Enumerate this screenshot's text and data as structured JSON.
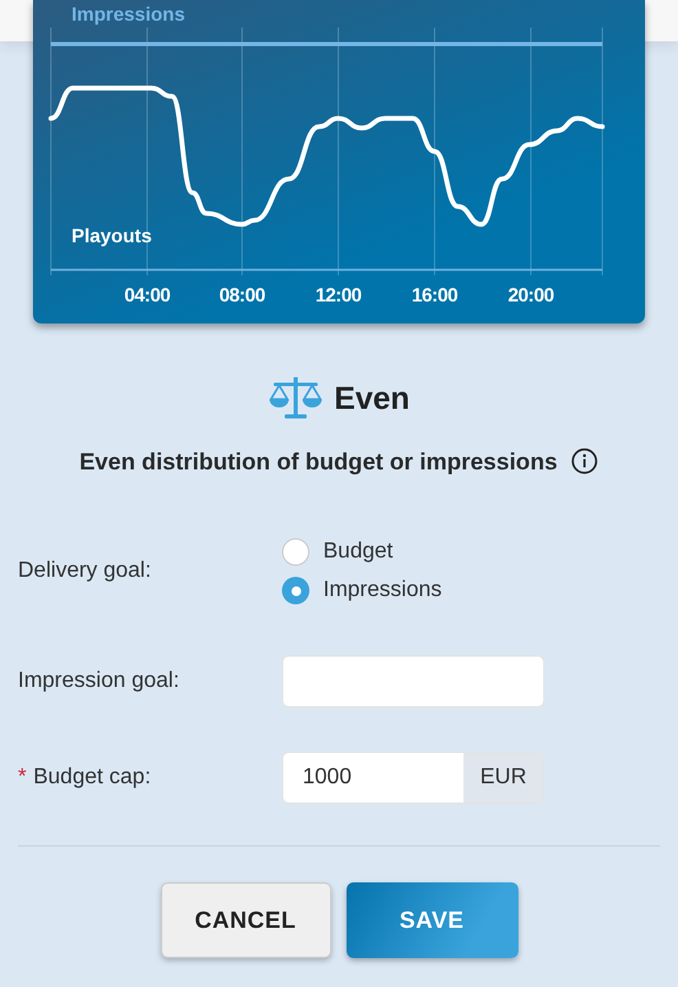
{
  "chart": {
    "top_label": "Impressions",
    "bottom_label": "Playouts",
    "x_ticks": [
      "04:00",
      "08:00",
      "12:00",
      "16:00",
      "20:00"
    ]
  },
  "strategy": {
    "title": "Even",
    "description": "Even distribution of budget or impressions"
  },
  "form": [
    {
      "kind": "radio",
      "label": "Delivery goal:",
      "options": [
        {
          "label": "Budget",
          "selected": false
        },
        {
          "label": "Impressions",
          "selected": true
        }
      ]
    },
    {
      "kind": "text",
      "label": "Impression goal:"
    },
    {
      "kind": "currency",
      "required_marker": "*",
      "label": "Budget cap:",
      "value": "1000",
      "unit": "EUR"
    }
  ],
  "buttons": [
    {
      "kind": "secondary",
      "label": "CANCEL"
    },
    {
      "kind": "primary",
      "label": "SAVE"
    }
  ]
}
